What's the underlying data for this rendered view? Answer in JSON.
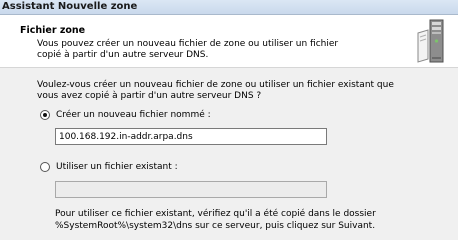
{
  "window": {
    "title": "Assistant Nouvelle zone"
  },
  "header": {
    "title": "Fichier zone",
    "description": "Vous pouvez créer un nouveau fichier de zone ou utiliser un fichier copié à partir d'un autre serveur DNS."
  },
  "body": {
    "intro": "Voulez-vous créer un nouveau fichier de zone ou utiliser un fichier existant que vous avez copié à partir d'un autre serveur DNS ?",
    "option_new": {
      "label": "Créer un nouveau fichier nommé :",
      "selected": true,
      "value": "100.168.192.in-addr.arpa.dns"
    },
    "option_existing": {
      "label": "Utiliser un fichier existant :",
      "selected": false,
      "value": ""
    },
    "note": "Pour utiliser ce fichier existant, vérifiez qu'il a été copié dans le dossier %SystemRoot%\\system32\\dns sur ce serveur, puis cliquez sur Suivant."
  },
  "icons": {
    "header": "server-icon"
  }
}
